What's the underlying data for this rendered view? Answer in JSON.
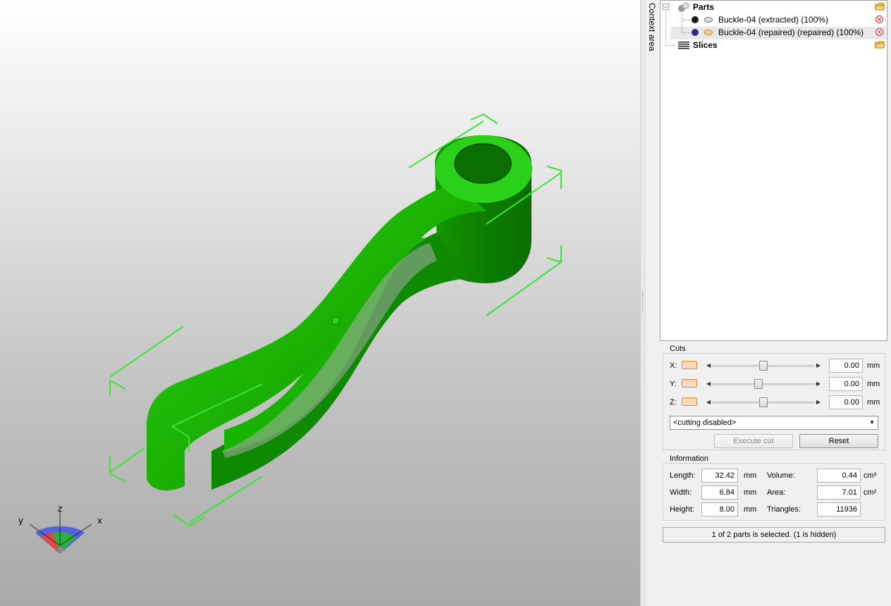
{
  "viewport": {
    "model_color": "#19b400",
    "bbox_color": "#39e635",
    "axes": {
      "x": "x",
      "y": "y",
      "z": "z"
    }
  },
  "context_tab": {
    "label": "Context area"
  },
  "tree": {
    "parts": {
      "label": "Parts",
      "icon": "parts-spheres-icon"
    },
    "items": [
      {
        "label": "Buckle-04 (extracted) (100%)",
        "color": "#1a1a1a",
        "visible": false
      },
      {
        "label": "Buckle-04 (repaired) (repaired) (100%)",
        "color": "#2b2b7a",
        "visible": true,
        "selected": true
      }
    ],
    "slices": {
      "label": "Slices",
      "icon": "slices-stack-icon"
    }
  },
  "cuts": {
    "title": "Cuts",
    "rows": [
      {
        "axis": "X:",
        "value": "0.00",
        "unit": "mm",
        "position": 0.5
      },
      {
        "axis": "Y:",
        "value": "0.00",
        "unit": "mm",
        "position": 0.45
      },
      {
        "axis": "Z:",
        "value": "0.00",
        "unit": "mm",
        "position": 0.5
      }
    ],
    "mode": "<cutting disabled>",
    "execute_label": "Execute cut",
    "reset_label": "Reset"
  },
  "information": {
    "title": "Information",
    "length_label": "Length:",
    "length": "32.42",
    "length_unit": "mm",
    "width_label": "Width:",
    "width": "6.84",
    "width_unit": "mm",
    "height_label": "Height:",
    "height": "8.00",
    "height_unit": "mm",
    "volume_label": "Volume:",
    "volume": "0.44",
    "volume_unit": "cm³",
    "area_label": "Area:",
    "area": "7.01",
    "area_unit": "cm²",
    "triangles_label": "Triangles:",
    "triangles": "11936"
  },
  "status": "1 of 2 parts is selected. (1 is hidden)"
}
